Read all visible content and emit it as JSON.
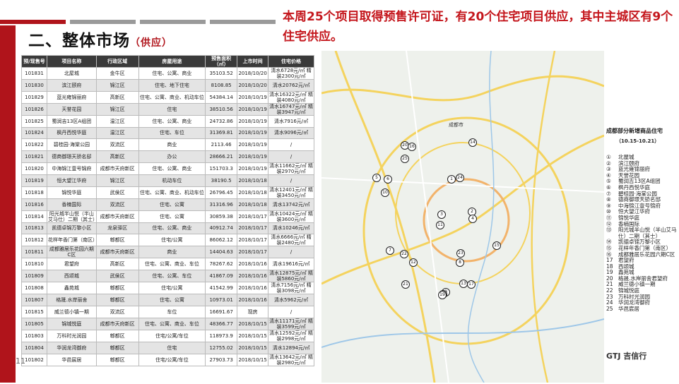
{
  "header": {
    "title": "二、整体市场",
    "subtitle": "（供应）",
    "headline": "本周25个项目取得预售许可证，有20个住宅项目供应，其中主城区有9个住宅供应。",
    "page_number": "11"
  },
  "table": {
    "columns": [
      "预/现售号",
      "项目名称",
      "行政区域",
      "房屋用途",
      "预售面积（㎡）",
      "上市时间",
      "住宅价格"
    ],
    "rows": [
      [
        "101831",
        "北屋城",
        "金牛区",
        "住宅、公寓、商业",
        "35103.52",
        "2018/10/20",
        "清水6728元/㎡ 精装2300元/㎡"
      ],
      [
        "101830",
        "滨江颐府",
        "锦江区",
        "住宅、地下住宅",
        "8108.85",
        "2018/10/20",
        "清水20762元/㎡"
      ],
      [
        "101829",
        "蓝光雍锦丽府",
        "高新区",
        "住宅、公寓、商业、机动车位",
        "54384.14",
        "2018/10/19",
        "清水16322元/㎡ 精装4080元/㎡"
      ],
      [
        "101826",
        "天誉花园",
        "锦江区",
        "住宅",
        "38510.56",
        "2018/10/19",
        "清水16747元/㎡ 精装3947元/㎡"
      ],
      [
        "101825",
        "蜀润吉13区A组团",
        "温江区",
        "住宅、公寓、商业",
        "24732.86",
        "2018/10/19",
        "清水7916元/㎡"
      ],
      [
        "101824",
        "枫丹西悦华庭",
        "温江区",
        "住宅、车位",
        "31369.81",
        "2018/10/19",
        "清水9096元/㎡"
      ],
      [
        "101822",
        "碧桂园·海棠公园",
        "双流区",
        "商业",
        "2113.46",
        "2018/10/19",
        "/"
      ],
      [
        "101821",
        "德商御璟天骄名邸",
        "高新区",
        "办公",
        "28666.21",
        "2018/10/19",
        "/"
      ],
      [
        "101820",
        "中海锦江壹号锦府",
        "成都市天府新区",
        "住宅、公寓、商业",
        "151703.3",
        "2018/10/19",
        "清水11662元/㎡ 精装2970元/㎡"
      ],
      [
        "101819",
        "恒大望江华府",
        "锦江区",
        "机动车位",
        "38190.5",
        "2018/10/18",
        "/"
      ],
      [
        "101818",
        "锦悦华庭",
        "武侯区",
        "住宅、公寓、商业、机动车位",
        "26796.45",
        "2018/10/18",
        "清水12401元/㎡ 精装3450元/㎡"
      ],
      [
        "101816",
        "香楠国际",
        "双流区",
        "住宅、公寓",
        "31316.96",
        "2018/10/18",
        "清水13742元/㎡"
      ],
      [
        "101814",
        "阳光城半山悦（半山艾马仕）二期（其士）",
        "成都市天府新区",
        "住宅、公寓",
        "30859.38",
        "2018/10/17",
        "清水10424元/㎡ 精装3600元/㎡"
      ],
      [
        "101813",
        "凯德卓锦万黎小区",
        "龙泉驿区",
        "住宅、公寓、商业",
        "40912.74",
        "2018/10/17",
        "清水10246元/㎡"
      ],
      [
        "101812",
        "花样年香门第（南区）",
        "郫都区",
        "住宅/公寓",
        "86062.12",
        "2018/10/17",
        "清水6666元/㎡ 精装2480元/㎡"
      ],
      [
        "101811",
        "成都雅居乐花园六期C区",
        "成都市天府新区",
        "商业",
        "14404.63",
        "2018/10/17",
        "/"
      ],
      [
        "101810",
        "君望府",
        "高新区",
        "住宅、公寓、商业、车位",
        "78267.62",
        "2018/10/16",
        "清水19616元/㎡"
      ],
      [
        "101809",
        "西颂城",
        "武侯区",
        "住宅、公寓、车位",
        "41867.09",
        "2018/10/16",
        "清水12875元/㎡ 精装5860元/㎡"
      ],
      [
        "101808",
        "鑫苑城",
        "郫都区",
        "住宅/公寓",
        "41542.99",
        "2018/10/16",
        "清水7156元/㎡ 精装3098元/㎡"
      ],
      [
        "101807",
        "格晟.水岸丽舍",
        "郫都区",
        "住宅、公寓",
        "10973.01",
        "2018/10/16",
        "清水5962元/㎡"
      ],
      [
        "101815",
        "威兰德小镇一期",
        "双流区",
        "车位",
        "16691.67",
        "现房",
        "/"
      ],
      [
        "101805",
        "锦城悦庭",
        "成都市天府新区",
        "住宅、公寓、商业、车位",
        "48366.77",
        "2018/10/15",
        "清水11171元/㎡ 精装3599元/㎡"
      ],
      [
        "101803",
        "万科时光润园",
        "郫都区",
        "住宅/公寓/车位",
        "118973.9",
        "2018/10/15",
        "清水12592元/㎡ 精装2998元/㎡"
      ],
      [
        "101804",
        "华润龙湾御府",
        "郫都区",
        "住宅",
        "12755.02",
        "2018/10/15",
        "清水12894元/㎡"
      ],
      [
        "101802",
        "华邑宸居",
        "郫都区",
        "住宅/公寓/车位",
        "27903.73",
        "2018/10/15",
        "清水13642元/㎡ 精装2980元/㎡"
      ]
    ]
  },
  "map": {
    "city_label": "成都市",
    "markers": [
      "20",
      "16",
      "25",
      "14",
      "24",
      "1",
      "5",
      "6",
      "10",
      "3",
      "2",
      "4",
      "11",
      "15",
      "7",
      "22",
      "12",
      "23",
      "8",
      "13",
      "17",
      "21",
      "9",
      "18",
      "19"
    ]
  },
  "legend": {
    "title": "成都部分新增商品住宅",
    "date_range": "（10.15-10.21）",
    "items": [
      [
        "①",
        "北屋城"
      ],
      [
        "②",
        "滨江颐府"
      ],
      [
        "③",
        "蓝光雍锦丽府"
      ],
      [
        "④",
        "天誉花园"
      ],
      [
        "⑤",
        "蜀润吉13区A组团"
      ],
      [
        "⑥",
        "枫丹西悦华庭"
      ],
      [
        "⑦",
        "碧桂园·海棠公园"
      ],
      [
        "⑧",
        "德商御璟天骄名邸"
      ],
      [
        "⑨",
        "中海锦江壹号锦府"
      ],
      [
        "⑩",
        "恒大望江华府"
      ],
      [
        "⑪",
        "锦悦华庭"
      ],
      [
        "⑫",
        "香楠国际"
      ],
      [
        "⑬",
        "阳光城半山悦（半山艾马仕）二期（其士）"
      ],
      [
        "⑭",
        "凯德卓锦万黎小区"
      ],
      [
        "⑮",
        "花样年香门第（南区）"
      ],
      [
        "⑯",
        "成都雅居乐花园六期C区"
      ],
      [
        "17",
        "君望府"
      ],
      [
        "18",
        "西颂城"
      ],
      [
        "19",
        "鑫苑城"
      ],
      [
        "20",
        "格晟.水岸丽舍君望府"
      ],
      [
        "21",
        "威兰德小镇一期"
      ],
      [
        "22",
        "锦城悦庭"
      ],
      [
        "23",
        "万科时光润园"
      ],
      [
        "24",
        "华润龙湾御府"
      ],
      [
        "25",
        "华邑宸居"
      ]
    ]
  },
  "logo": "GTJ 吉信行"
}
